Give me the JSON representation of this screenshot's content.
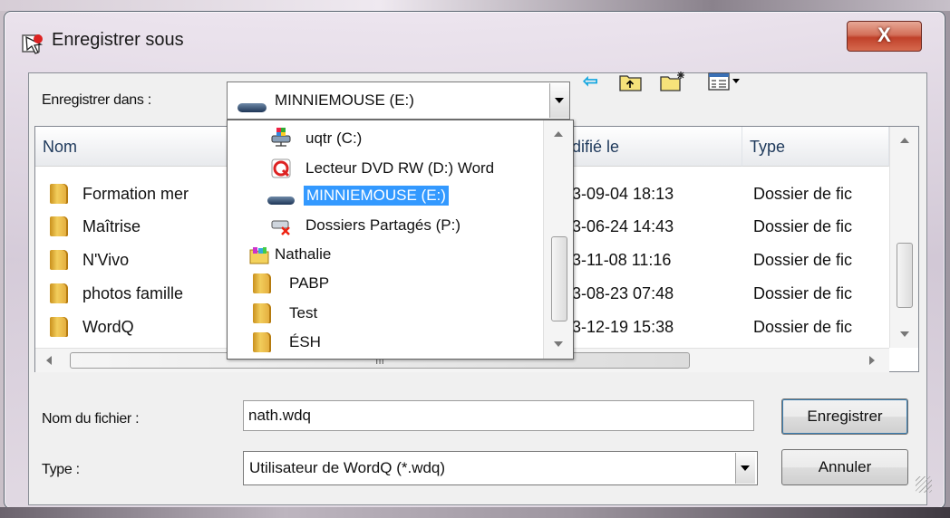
{
  "window": {
    "title": "Enregistrer sous",
    "close_label": "X"
  },
  "toolbar": {
    "save_in_label": "Enregistrer dans :",
    "location_value": "MINNIEMOUSE (E:)",
    "icons": [
      "back-arrow-icon",
      "up-folder-icon",
      "new-folder-icon",
      "view-menu-icon"
    ]
  },
  "file_list": {
    "columns": [
      "Nom",
      "difié le",
      "Type"
    ],
    "rows": [
      {
        "name": "Formation mer",
        "modified": "3-09-04 18:13",
        "type": "Dossier de fic"
      },
      {
        "name": "Maîtrise",
        "modified": "3-06-24 14:43",
        "type": "Dossier de fic"
      },
      {
        "name": "N'Vivo",
        "modified": "3-11-08 11:16",
        "type": "Dossier de fic"
      },
      {
        "name": "photos famille",
        "modified": "3-08-23 07:48",
        "type": "Dossier de fic"
      },
      {
        "name": "WordQ",
        "modified": "3-12-19 15:38",
        "type": "Dossier de fic"
      }
    ],
    "hscroll_grip": "III"
  },
  "location_dropdown": {
    "items": [
      {
        "label": "uqtr (C:)",
        "icon": "network-drive-icon"
      },
      {
        "label": "Lecteur DVD RW (D:) Word",
        "icon": "dvd-drive-icon"
      },
      {
        "label": "MINNIEMOUSE (E:)",
        "icon": "removable-drive-icon",
        "selected": true
      },
      {
        "label": "Dossiers Partagés (P:)",
        "icon": "disconnected-drive-icon"
      },
      {
        "label": "Nathalie",
        "icon": "user-folder-icon"
      },
      {
        "label": "PABP",
        "icon": "folder-icon"
      },
      {
        "label": "Test",
        "icon": "folder-icon"
      },
      {
        "label": "ÉSH",
        "icon": "folder-icon"
      }
    ]
  },
  "form": {
    "filename_label": "Nom du fichier :",
    "filename_value": "nath.wdq",
    "type_label": "Type :",
    "type_value": "Utilisateur de WordQ (*.wdq)",
    "save_button": "Enregistrer",
    "cancel_button": "Annuler"
  },
  "colors": {
    "selection": "#3399ff",
    "close_button": "#c0412a",
    "header_text": "#1e395b"
  }
}
